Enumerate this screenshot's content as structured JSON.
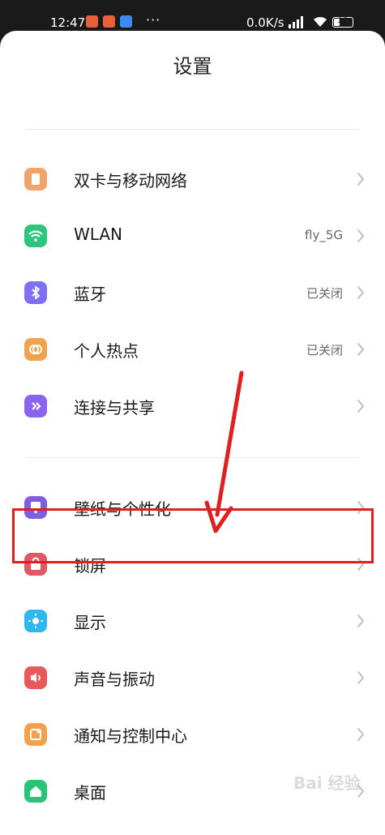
{
  "status_bar": {
    "time": "12:47",
    "dots": "···",
    "net_speed": "0.0K/s",
    "battery": "35",
    "battery_level": 0.35
  },
  "page": {
    "title": "设置"
  },
  "settings": [
    {
      "label": "双卡与移动网络",
      "value": "",
      "icon": "sim-card-icon",
      "color": "#f0a46a"
    },
    {
      "label": "WLAN",
      "value": "fly_5G",
      "icon": "wifi-icon",
      "color": "#2fc47b"
    },
    {
      "label": "蓝牙",
      "value": "已关闭",
      "icon": "bluetooth-icon",
      "color": "#7f6ff2"
    },
    {
      "label": "个人热点",
      "value": "已关闭",
      "icon": "hotspot-icon",
      "color": "#f0a24f"
    },
    {
      "label": "连接与共享",
      "value": "",
      "icon": "connection-icon",
      "color": "#8a63f0"
    },
    {
      "label": "壁纸与个性化",
      "value": "",
      "icon": "wallpaper-icon",
      "color": "#7f5fe0"
    },
    {
      "label": "锁屏",
      "value": "",
      "icon": "lock-icon",
      "color": "#e05a66"
    },
    {
      "label": "显示",
      "value": "",
      "icon": "display-icon",
      "color": "#2fb8f0"
    },
    {
      "label": "声音与振动",
      "value": "",
      "icon": "sound-icon",
      "color": "#e85a5a"
    },
    {
      "label": "通知与控制中心",
      "value": "",
      "icon": "notification-icon",
      "color": "#f3a04f"
    },
    {
      "label": "桌面",
      "value": "",
      "icon": "home-icon",
      "color": "#2cc278"
    }
  ],
  "annotation": {
    "highlight_color": "#e02020"
  },
  "watermark": "Bai 经验"
}
